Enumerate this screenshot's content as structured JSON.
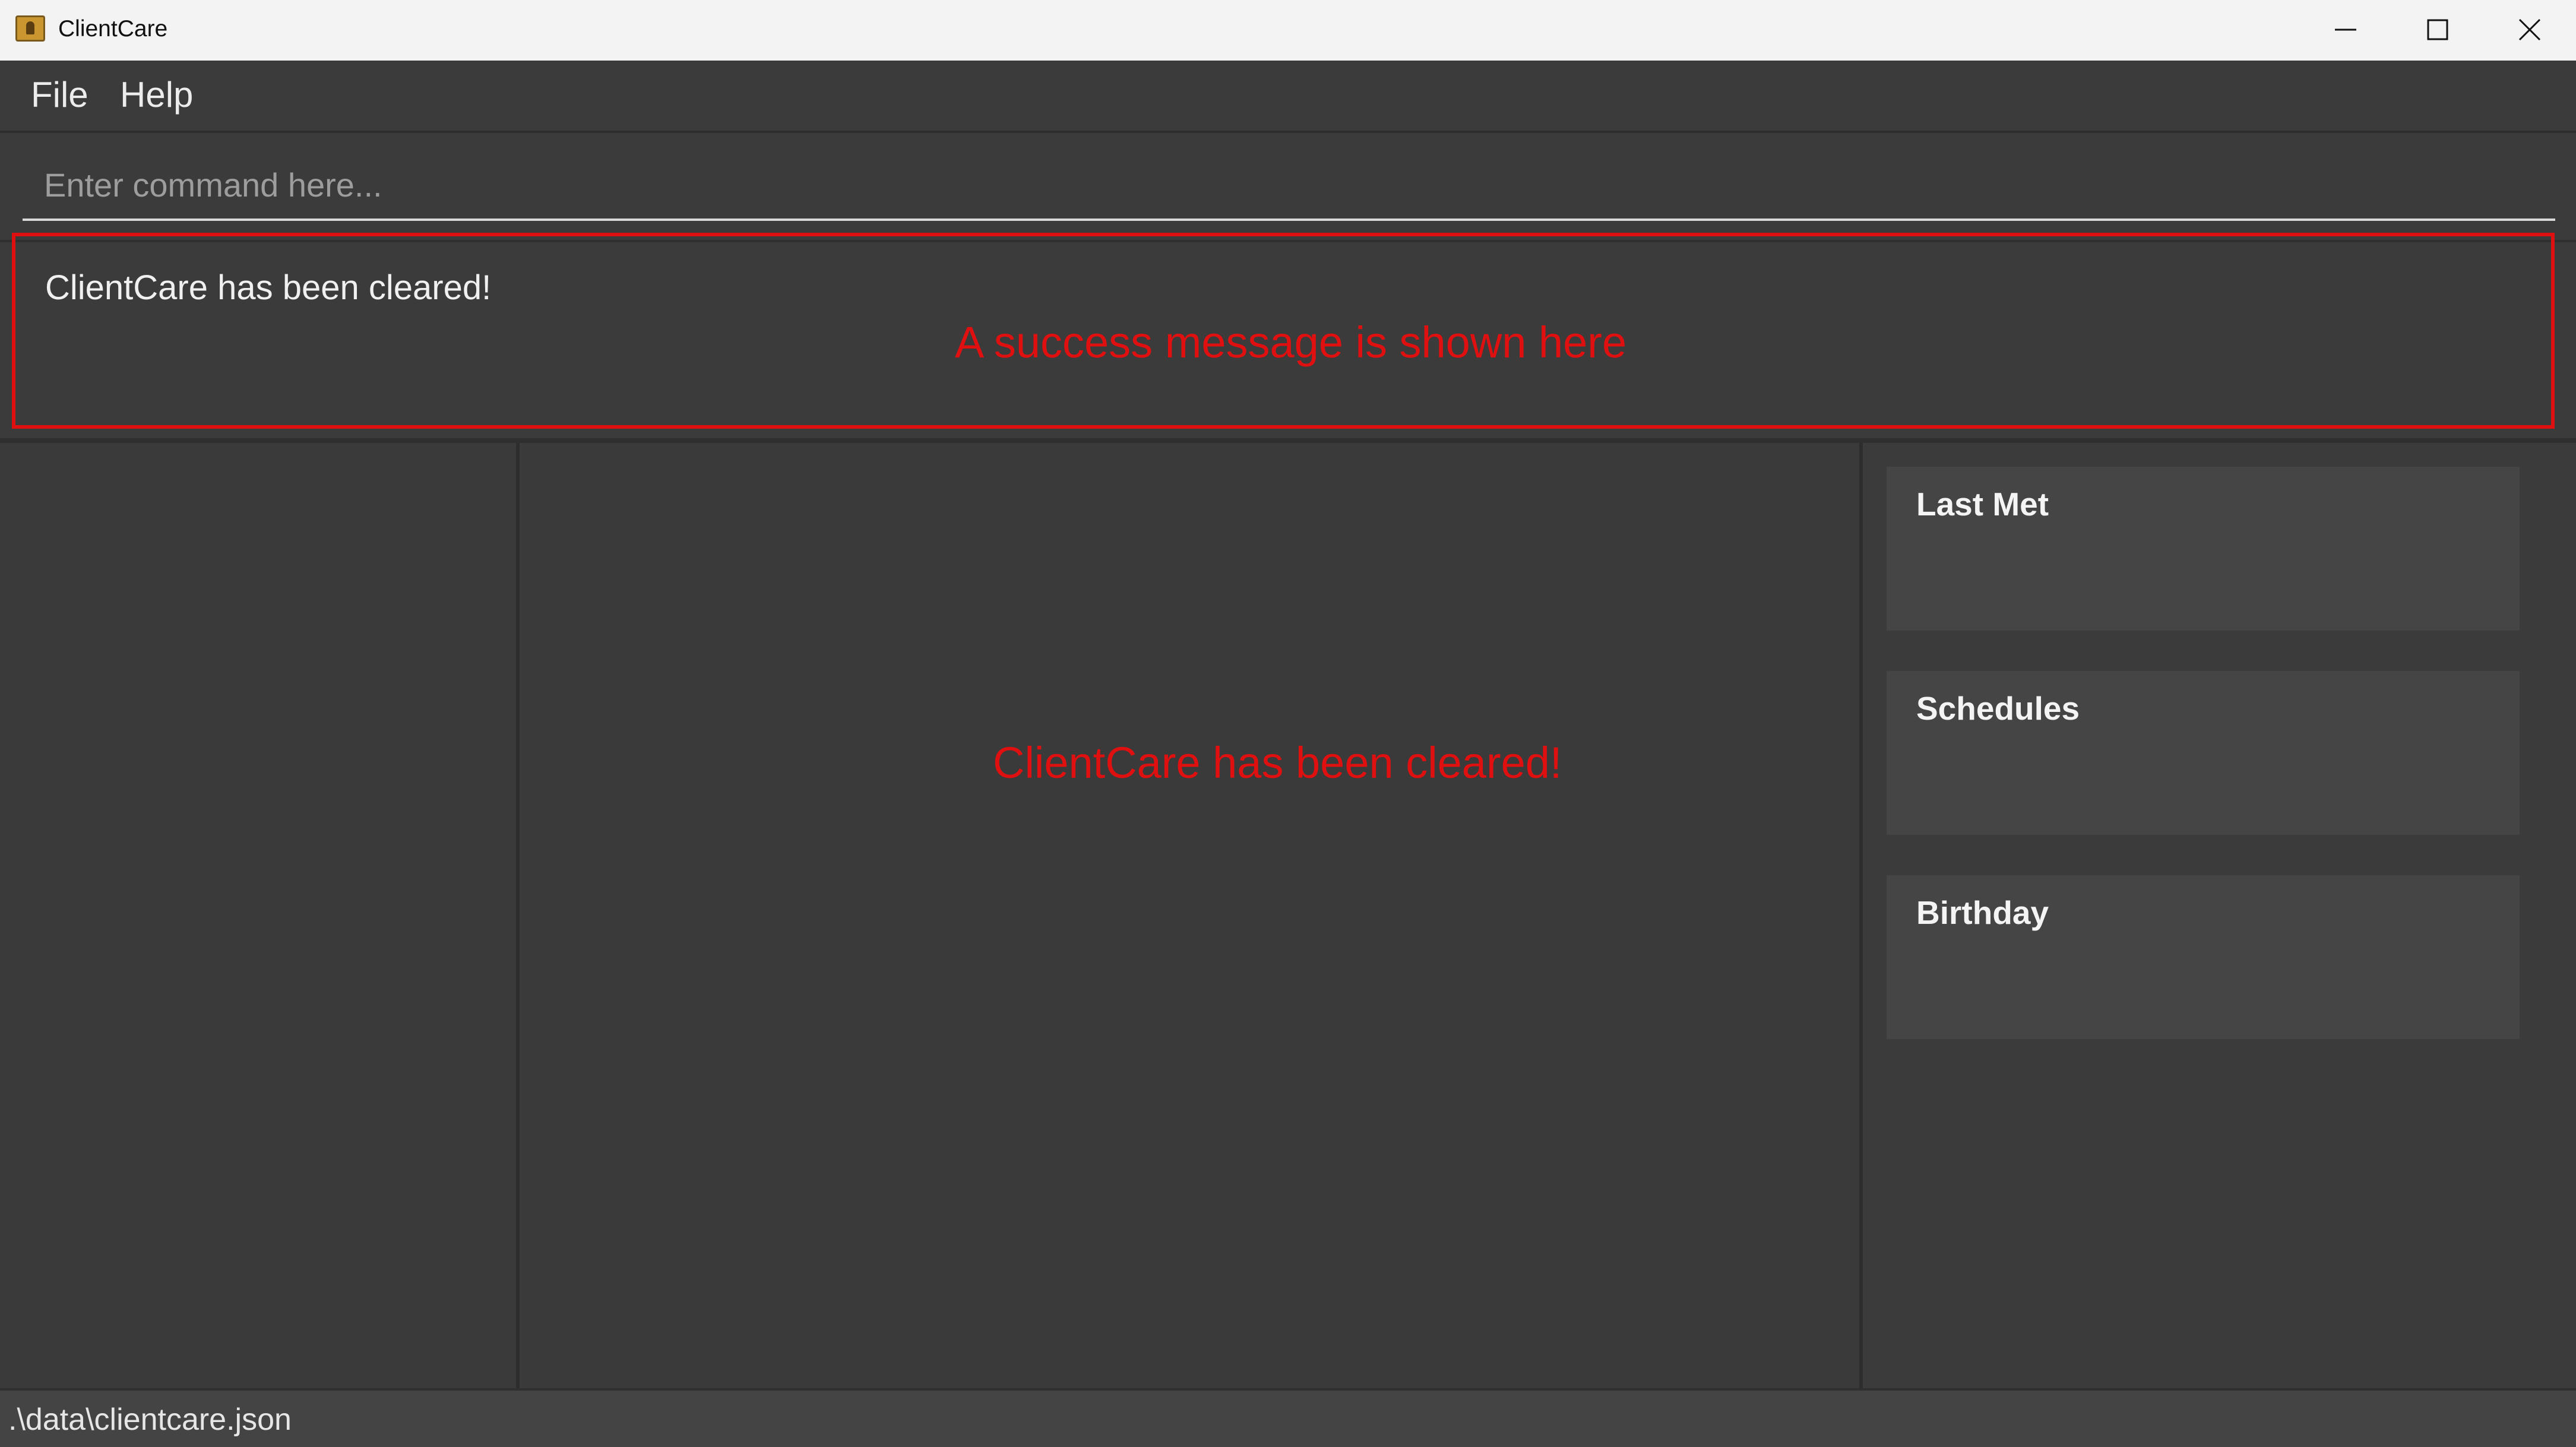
{
  "window": {
    "title": "ClientCare"
  },
  "menu": {
    "items": [
      {
        "label": "File"
      },
      {
        "label": "Help"
      }
    ]
  },
  "command": {
    "value": "",
    "placeholder": "Enter command here..."
  },
  "result": {
    "message": "ClientCare has been cleared!"
  },
  "annotations": {
    "result_note": "A success message is shown here",
    "center_note": "ClientCare has been cleared!",
    "color": "#e01010"
  },
  "side_panels": [
    {
      "title": "Last Met"
    },
    {
      "title": "Schedules"
    },
    {
      "title": "Birthday"
    }
  ],
  "status": {
    "path": ".\\data\\clientcare.json"
  },
  "icons": {
    "app": "person-badge-icon",
    "minimize": "minimize-icon",
    "maximize": "maximize-icon",
    "close": "close-icon"
  }
}
